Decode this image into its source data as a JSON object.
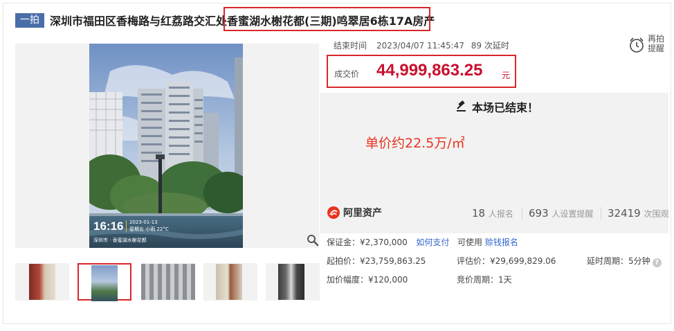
{
  "header": {
    "tag": "一拍",
    "title": "深圳市福田区香梅路与红荔路交汇处香蜜湖水榭花都(三期)鸣翠居6栋17A房产"
  },
  "photo_overlay": {
    "time": "16:16",
    "date": "2023-01-13",
    "weather": "星期五 小雨 22°C",
    "location": "深圳市 · 香蜜湖水榭花都"
  },
  "auction": {
    "end_label": "结束时间",
    "end_time": "2023/04/07 11:45:47",
    "delay_count": "89",
    "delay_label": "次延时",
    "reminder_line1": "再拍",
    "reminder_line2": "提醒",
    "price_label": "成交价",
    "price_value": "44,999,863.25",
    "price_unit": "元",
    "ended_text": "本场已结束！",
    "unit_price_note": "单价约22.5万/㎡"
  },
  "platform": {
    "logo_text": "阿里资产"
  },
  "stats": {
    "signups": "18",
    "signups_label": "人报名",
    "reminders": "693",
    "reminders_label": "人设置提醒",
    "views": "32419",
    "views_label": "次围观"
  },
  "details": {
    "deposit": "保证金：¥2,370,000",
    "pay_link": "如何支付",
    "can_use": "可使用",
    "credit_link": "赊钱报名",
    "start_price": "起拍价：¥23,759,863.25",
    "appraisal": "评估价：¥29,699,829.06",
    "delay_period": "延时周期：5分钟",
    "increment": "加价幅度：¥120,000",
    "bid_period": "竞价周期：1天"
  },
  "colors": {
    "accent_red": "#c8102e",
    "highlight_border": "#d9252a",
    "link_blue": "#3366cc",
    "tag_blue": "#4a6ea9"
  }
}
